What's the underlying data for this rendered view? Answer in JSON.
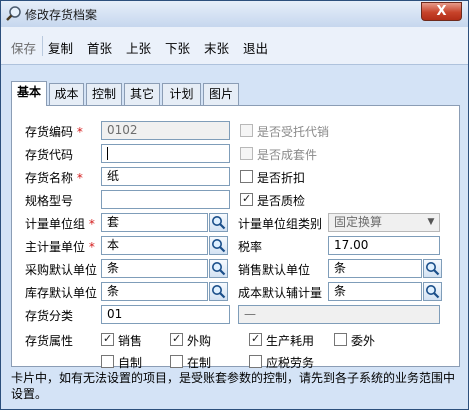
{
  "window": {
    "title": "修改存货档案",
    "close_label": "X"
  },
  "toolbar": {
    "save": "保存",
    "copy": "复制",
    "first": "首张",
    "prev": "上张",
    "next": "下张",
    "last": "末张",
    "exit": "退出"
  },
  "tabs": [
    "基本",
    "成本",
    "控制",
    "其它",
    "计划",
    "图片"
  ],
  "form": {
    "inventory_code": {
      "label": "存货编码",
      "value": "0102"
    },
    "inventory_abbr": {
      "label": "存货代码",
      "value": ""
    },
    "inventory_name": {
      "label": "存货名称",
      "value": "纸"
    },
    "spec_model": {
      "label": "规格型号",
      "value": ""
    },
    "uom_group": {
      "label": "计量单位组",
      "value": "套"
    },
    "main_uom": {
      "label": "主计量单位",
      "value": "本"
    },
    "purchase_uom": {
      "label": "采购默认单位",
      "value": "条"
    },
    "stock_uom": {
      "label": "库存默认单位",
      "value": "条"
    },
    "inventory_class": {
      "label": "存货分类",
      "value": "01"
    },
    "uom_group_type": {
      "label": "计量单位组类别",
      "value": "固定换算"
    },
    "tax_rate": {
      "label": "税率",
      "value": "17.00"
    },
    "sales_uom": {
      "label": "销售默认单位",
      "value": "条"
    },
    "cost_aux_uom": {
      "label": "成本默认辅计量",
      "value": "条"
    },
    "class_name": {
      "value": "—"
    },
    "attr_label": "存货属性",
    "required_mark": "*"
  },
  "options": {
    "consign": {
      "label": "是否受托代销",
      "checked": false,
      "enabled": false
    },
    "kit": {
      "label": "是否成套件",
      "checked": false,
      "enabled": false
    },
    "discount": {
      "label": "是否折扣",
      "checked": false,
      "enabled": true
    },
    "quality": {
      "label": "是否质检",
      "checked": true,
      "enabled": true
    }
  },
  "attributes": {
    "sale": {
      "label": "销售",
      "checked": true
    },
    "purchase": {
      "label": "外购",
      "checked": true
    },
    "production": {
      "label": "生产耗用",
      "checked": true
    },
    "outsource": {
      "label": "委外",
      "checked": false
    },
    "self_made": {
      "label": "自制",
      "checked": false
    },
    "in_process": {
      "label": "在制",
      "checked": false
    },
    "service": {
      "label": "应税劳务",
      "checked": false
    }
  },
  "note": "卡片中，如有无法设置的项目，是受账套参数的控制，请先到各子系统的业务范围中设置。"
}
